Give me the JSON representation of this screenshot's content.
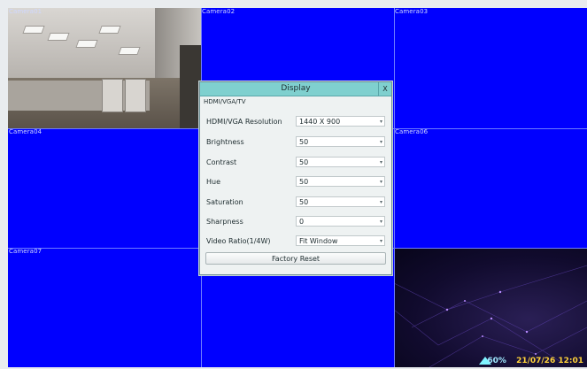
{
  "cameras": {
    "cam1": "Camera01",
    "cam2": "Camera02",
    "cam3": "Camera03",
    "cam4": "Camera04",
    "cam6": "Camera06",
    "cam7": "Camera07"
  },
  "dialog": {
    "title": "Display",
    "close_label": "X",
    "section": "HDMI/VGA/TV",
    "rows": [
      {
        "label": "HDMI/VGA Resolution",
        "value": "1440 X 900"
      },
      {
        "label": "Brightness",
        "value": "50"
      },
      {
        "label": "Contrast",
        "value": "50"
      },
      {
        "label": "Hue",
        "value": "50"
      },
      {
        "label": "Saturation",
        "value": "50"
      },
      {
        "label": "Sharpness",
        "value": "0"
      },
      {
        "label": "Video Ratio(1/4W)",
        "value": "Fit Window"
      }
    ],
    "reset_label": "Factory Reset"
  },
  "status": {
    "percent": "60%",
    "datetime": "21/07/26 12:01"
  },
  "colors": {
    "tile_blue": "#0000ff",
    "dialog_title": "#7fd0cf",
    "status_date": "#ffd23a"
  }
}
